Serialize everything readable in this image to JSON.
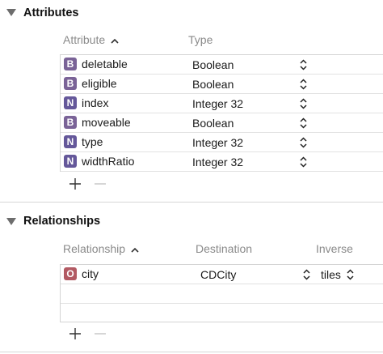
{
  "colors": {
    "badge_boolean": "#7a6397",
    "badge_number": "#65589a",
    "badge_object": "#b25a63"
  },
  "attributes": {
    "title": "Attributes",
    "columns": {
      "attribute": "Attribute",
      "type": "Type"
    },
    "rows": [
      {
        "badge": "B",
        "name": "deletable",
        "type": "Boolean"
      },
      {
        "badge": "B",
        "name": "eligible",
        "type": "Boolean"
      },
      {
        "badge": "N",
        "name": "index",
        "type": "Integer 32"
      },
      {
        "badge": "B",
        "name": "moveable",
        "type": "Boolean"
      },
      {
        "badge": "N",
        "name": "type",
        "type": "Integer 32"
      },
      {
        "badge": "N",
        "name": "widthRatio",
        "type": "Integer 32"
      }
    ],
    "add_label": "+",
    "remove_label": "−"
  },
  "relationships": {
    "title": "Relationships",
    "columns": {
      "relationship": "Relationship",
      "destination": "Destination",
      "inverse": "Inverse"
    },
    "rows": [
      {
        "badge": "O",
        "name": "city",
        "destination": "CDCity",
        "inverse": "tiles"
      }
    ],
    "add_label": "+",
    "remove_label": "−"
  }
}
